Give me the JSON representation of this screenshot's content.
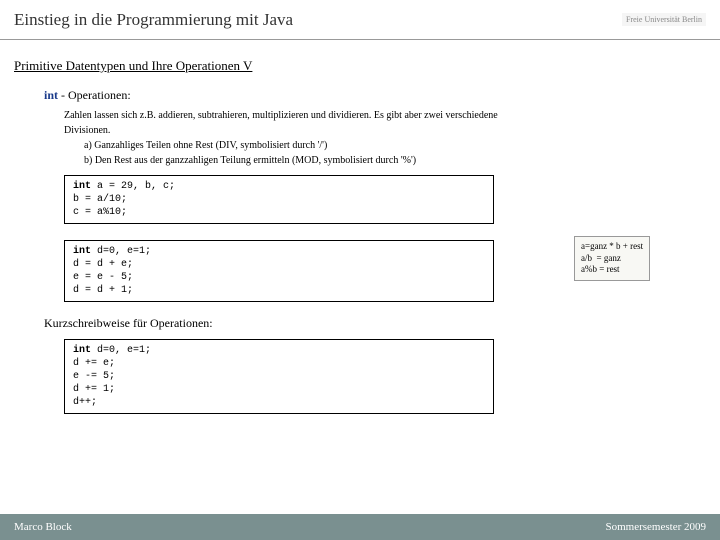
{
  "header": {
    "title": "Einstieg in die Programmierung mit Java",
    "logo": "Freie Universität Berlin"
  },
  "subtitle": "Primitive Datentypen und Ihre Operationen V",
  "section": {
    "kw": "int",
    "rest": " - Operationen:"
  },
  "body": {
    "l1": "Zahlen lassen sich z.B. addieren, subtrahieren, multiplizieren und dividieren. Es gibt aber zwei verschiedene",
    "l2": "Divisionen.",
    "l3": "a) Ganzahliges Teilen ohne Rest (DIV, symbolisiert durch '/')",
    "l4": "b) Den Rest aus der ganzzahligen Teilung ermitteln (MOD, symbolisiert durch '%')"
  },
  "code1": "int a = 29, b, c;\nb = a/10;\nc = a%10;",
  "code2": "int d=0, e=1;\nd = d + e;\ne = e - 5;\nd = d + 1;",
  "note": "a=ganz * b + rest\na/b  = ganz\na%b = rest",
  "subhead": "Kurzschreibweise für Operationen:",
  "code3": "int d=0, e=1;\nd += e;\ne -= 5;\nd += 1;\nd++;",
  "footer": {
    "left": "Marco Block",
    "right": "Sommersemester 2009"
  }
}
